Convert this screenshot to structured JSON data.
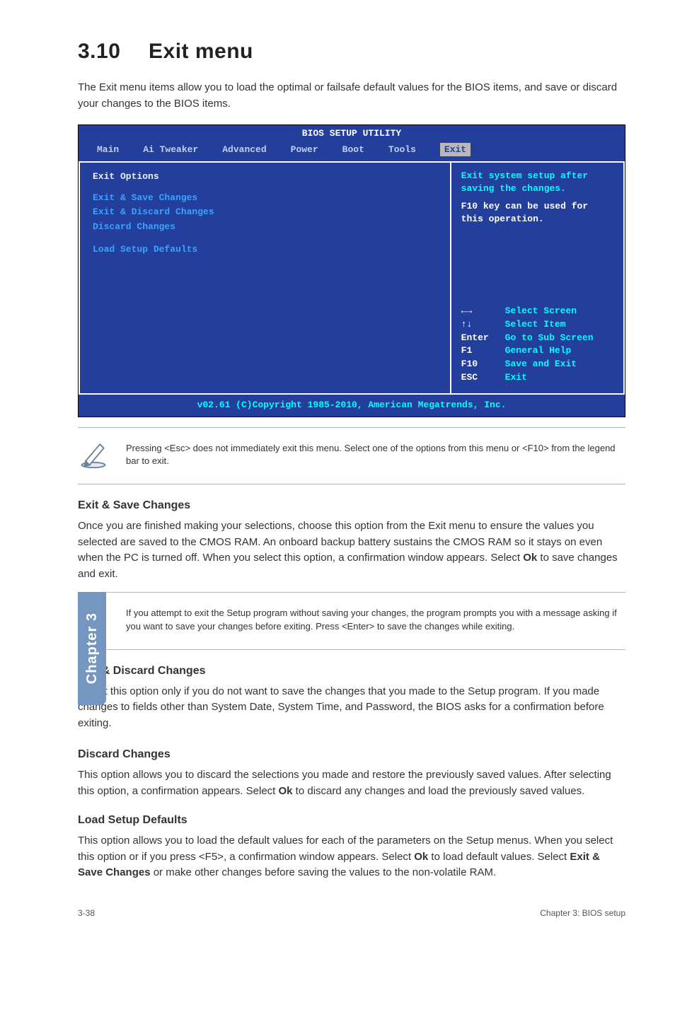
{
  "heading": {
    "number": "3.10",
    "title": "Exit menu"
  },
  "lead": "The Exit menu items allow you to load the optimal or failsafe default values for the BIOS items, and save or discard your changes to the BIOS items.",
  "bios": {
    "banner": "BIOS SETUP UTILITY",
    "tabs": [
      "Main",
      "Ai Tweaker",
      "Advanced",
      "Power",
      "Boot",
      "Tools",
      "Exit"
    ],
    "activeTab": 6,
    "leftHeader": "Exit Options",
    "leftItems": [
      "Exit & Save Changes",
      "Exit & Discard Changes",
      "Discard Changes",
      "",
      "Load Setup Defaults"
    ],
    "help": [
      {
        "text": "Exit system setup after saving the changes.",
        "class": "cyan"
      },
      {
        "text": "",
        "class": "cyan"
      },
      {
        "text": "F10 key can be used for this operation.",
        "class": "white"
      }
    ],
    "legend": [
      {
        "k": "←→",
        "v": "Select Screen"
      },
      {
        "k": "↑↓",
        "v": "Select Item"
      },
      {
        "k": "Enter",
        "v": "Go to Sub Screen"
      },
      {
        "k": "F1",
        "v": "General Help"
      },
      {
        "k": "F10",
        "v": "Save and Exit"
      },
      {
        "k": "ESC",
        "v": "Exit"
      }
    ],
    "footer": "v02.61 (C)Copyright 1985-2010, American Megatrends, Inc."
  },
  "note1": "Pressing <Esc> does not immediately exit this menu. Select one of the options from this menu or <F10> from the legend bar to exit.",
  "sections": {
    "s1": {
      "title": "Exit & Save Changes",
      "body_a": "Once you are finished making your selections, choose this option from the Exit menu to ensure the values you selected are saved to the CMOS RAM. An onboard backup battery sustains the CMOS RAM so it stays on even when the PC is turned off. When you select this option, a confirmation window appears. Select ",
      "body_bold": "Ok",
      "body_b": " to save changes and exit."
    },
    "s2": {
      "title": "Exit & Discard Changes",
      "body": "Select this option only if you do not want to save the changes that you made to the Setup program. If you made changes to fields other than System Date, System Time, and Password, the BIOS asks for a confirmation before exiting."
    },
    "s3": {
      "title": "Discard Changes",
      "body_a": "This option allows you to discard the selections you made and restore the previously saved values. After selecting this option, a confirmation appears. Select ",
      "body_bold": "Ok",
      "body_b": " to discard any changes and load the previously saved values."
    },
    "s4": {
      "title": "Load Setup Defaults",
      "body_a": "This option allows you to load the default values for each of the parameters on the Setup menus. When you select this option or if you press <F5>, a confirmation window appears. Select ",
      "body_bold1": "Ok",
      "body_b": " to load default values. Select ",
      "body_bold2": "Exit & Save Changes",
      "body_c": " or make other changes before saving the values to the non-volatile RAM."
    }
  },
  "note2": "If you attempt to exit the Setup program without saving your changes, the program prompts you with a message asking if you want to save your changes before exiting. Press <Enter> to save the changes while exiting.",
  "sidetab": "Chapter 3",
  "footer": {
    "left": "3-38",
    "right": "Chapter 3: BIOS setup"
  }
}
